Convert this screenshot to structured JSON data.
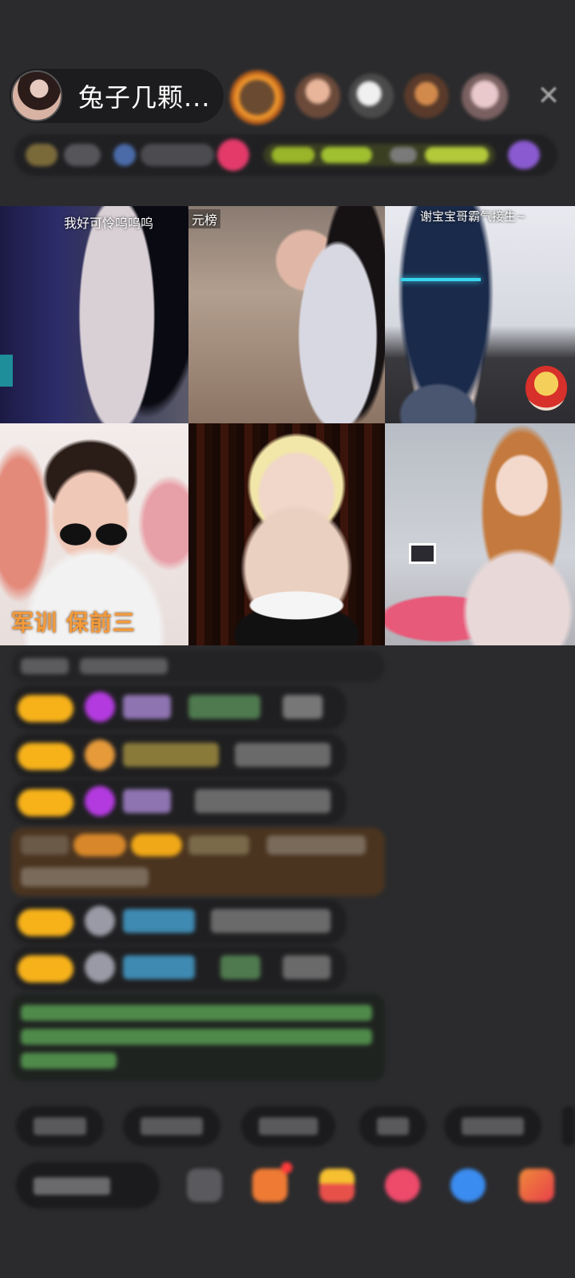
{
  "header": {
    "host_name": "兔子几颗...",
    "viewers": [
      {
        "name": "viewer-1-avatar",
        "color": "#e8902a"
      },
      {
        "name": "viewer-2-avatar",
        "color": "#c59070"
      },
      {
        "name": "viewer-3-avatar",
        "color": "#d9d9d9"
      },
      {
        "name": "viewer-4-avatar",
        "color": "#c47a3a"
      },
      {
        "name": "viewer-5-avatar",
        "color": "#d7b3b8"
      }
    ],
    "close_glyph": "✕"
  },
  "grid": {
    "tiles": [
      {
        "caption": "我好可怜呜呜呜",
        "badge": ""
      },
      {
        "caption": "元榜",
        "badge": ""
      },
      {
        "caption": "谢宝宝哥霸气接生~",
        "badge": ""
      },
      {
        "caption": "",
        "badge": "军训 保前三"
      },
      {
        "caption": "",
        "badge": ""
      },
      {
        "caption": "",
        "badge": ""
      }
    ]
  },
  "colors": {
    "background": "#2b2b2d",
    "level_badge": "#f7b21a",
    "badge_text": "#f39a3b"
  }
}
